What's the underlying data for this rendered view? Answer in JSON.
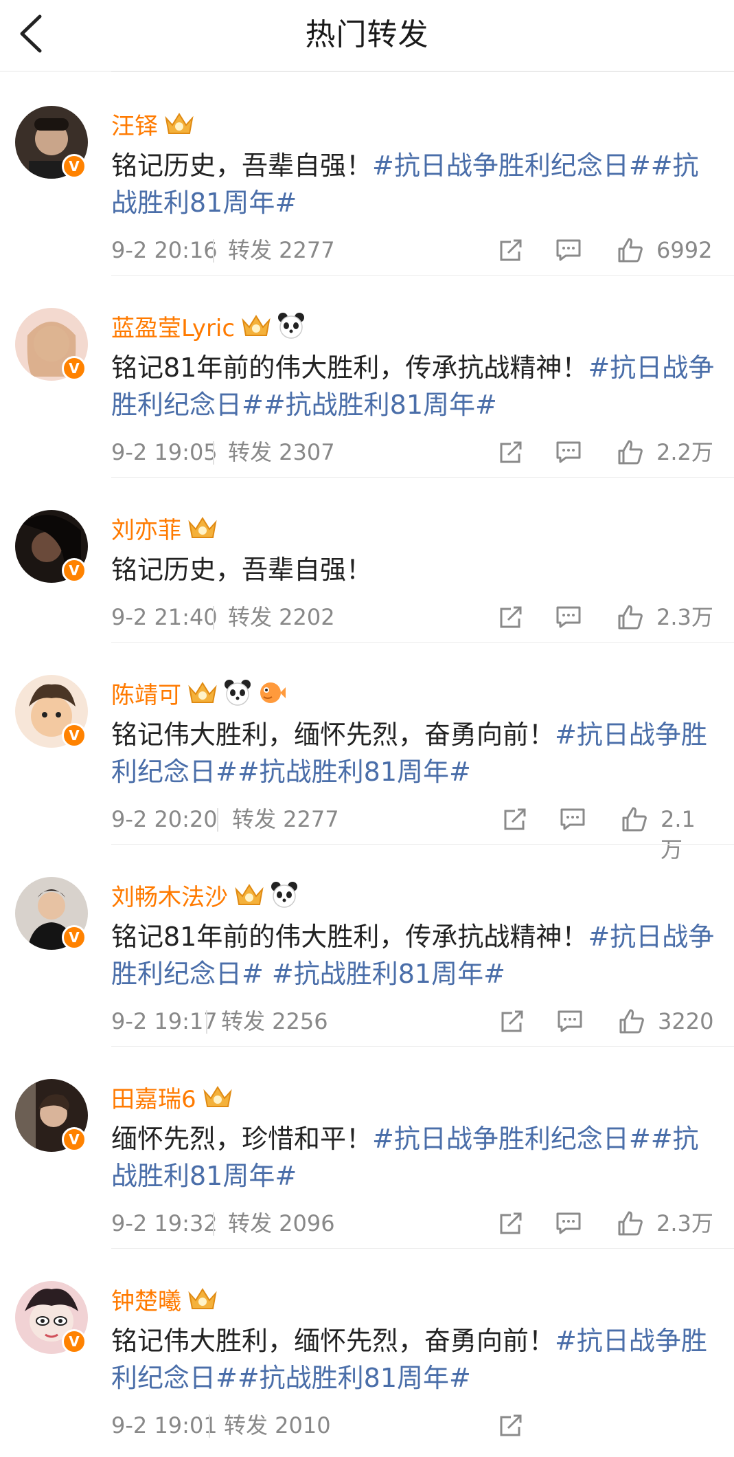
{
  "header": {
    "title": "热门转发"
  },
  "posts": [
    {
      "name": "汪铎",
      "badges": [
        "crown",
        "crown"
      ],
      "text": "铭记历史，吾辈自强！",
      "tags": "#抗日战争胜利纪念日##抗战胜利81周年#",
      "time": "9-2 20:16",
      "repost": "转发 2277",
      "likes": "6992"
    },
    {
      "name": "蓝盈莹Lyric",
      "text": "铭记81年前的伟大胜利，传承抗战精神！",
      "tags": "#抗日战争胜利纪念日##抗战胜利81周年#",
      "time": "9-2 19:05",
      "repost": "转发 2307",
      "likes": "2.2万"
    },
    {
      "name": "刘亦菲",
      "text": "铭记历史，吾辈自强！",
      "tags": "",
      "time": "9-2 21:40",
      "repost": "转发 2202",
      "likes": "2.3万"
    },
    {
      "name": "陈靖可",
      "text": "铭记伟大胜利，缅怀先烈，奋勇向前！",
      "tags": "#抗日战争胜利纪念日##抗战胜利81周年#",
      "time": "9-2 20:20",
      "repost": "转发 2277",
      "likes": "2.1万"
    },
    {
      "name": "刘畅木法沙",
      "text": "铭记81年前的伟大胜利，传承抗战精神！",
      "tags": "#抗日战争胜利纪念日# #抗战胜利81周年#",
      "time": "9-2 19:17",
      "repost": "转发 2256",
      "likes": "3220"
    },
    {
      "name": "田嘉瑞6",
      "text": "缅怀先烈，珍惜和平！",
      "tags": "#抗日战争胜利纪念日##抗战胜利81周年#",
      "time": "9-2 19:32",
      "repost": "转发 2096",
      "likes": "2.3万"
    },
    {
      "name": "钟楚曦",
      "text": "铭记伟大胜利，缅怀先烈，奋勇向前！",
      "tags": "#抗日战争胜利纪念日##抗战胜利81周年#",
      "time": "9-2 19:01",
      "repost": "转发 2010",
      "likes": ""
    }
  ],
  "colors": {
    "username": "#ff7a00",
    "hashtag": "#4a6ea9",
    "meta": "#888888",
    "verified": "#ff8200"
  }
}
